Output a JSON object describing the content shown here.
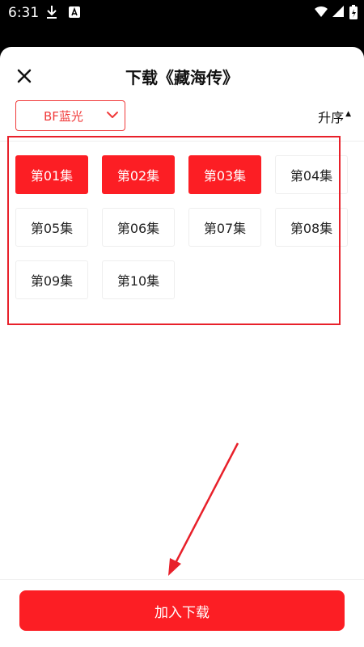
{
  "status_bar": {
    "time": "6:31"
  },
  "sheet": {
    "title": "下载《藏海传》",
    "quality": "BF蓝光",
    "sort": "升序",
    "episodes": [
      {
        "label": "第01集",
        "selected": true
      },
      {
        "label": "第02集",
        "selected": true
      },
      {
        "label": "第03集",
        "selected": true
      },
      {
        "label": "第04集",
        "selected": false
      },
      {
        "label": "第05集",
        "selected": false
      },
      {
        "label": "第06集",
        "selected": false
      },
      {
        "label": "第07集",
        "selected": false
      },
      {
        "label": "第08集",
        "selected": false
      },
      {
        "label": "第09集",
        "selected": false
      },
      {
        "label": "第10集",
        "selected": false
      }
    ],
    "add_button": "加入下载"
  },
  "colors": {
    "accent": "#fc1e24",
    "annotation": "#e8202a"
  }
}
